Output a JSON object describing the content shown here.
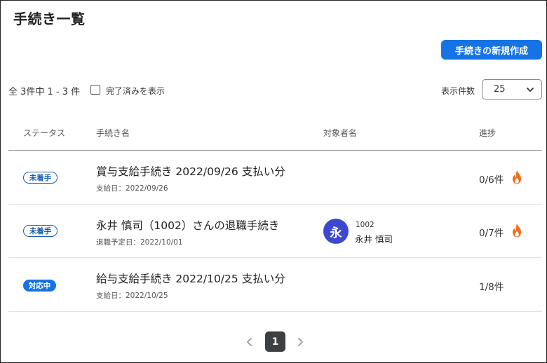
{
  "page": {
    "title": "手続き一覧"
  },
  "toolbar": {
    "create_button": "手続きの新規作成",
    "count_text": "全 3件中 1 - 3 件",
    "show_completed_label": "完了済みを表示",
    "show_completed_checked": false,
    "per_page_label": "表示件数",
    "per_page_value": "25"
  },
  "table": {
    "headers": {
      "status": "ステータス",
      "procedure": "手続き名",
      "target": "対象者名",
      "progress": "進捗"
    },
    "rows": [
      {
        "status": "未着手",
        "status_kind": "todo",
        "name": "賞与支給手続き 2022/09/26 支払い分",
        "sub": "支給日：2022/09/26",
        "employee": null,
        "progress": "0/6件",
        "hot": true
      },
      {
        "status": "未着手",
        "status_kind": "todo",
        "name": "永井 慎司（1002）さんの退職手続き",
        "sub": "退職予定日：2022/10/01",
        "employee": {
          "avatar_char": "永",
          "number": "1002",
          "name": "永井 慎司"
        },
        "progress": "0/7件",
        "hot": true
      },
      {
        "status": "対応中",
        "status_kind": "doing",
        "name": "給与支給手続き 2022/10/25 支払い分",
        "sub": "支給日：2022/10/25",
        "employee": null,
        "progress": "1/8件",
        "hot": false
      }
    ]
  },
  "pagination": {
    "current_page": "1"
  },
  "colors": {
    "primary": "#1673e6",
    "badge_outline": "#1a5fb4",
    "avatar": "#3d48d1",
    "fire": "#f36b1c",
    "pager_active": "#3c4043"
  }
}
